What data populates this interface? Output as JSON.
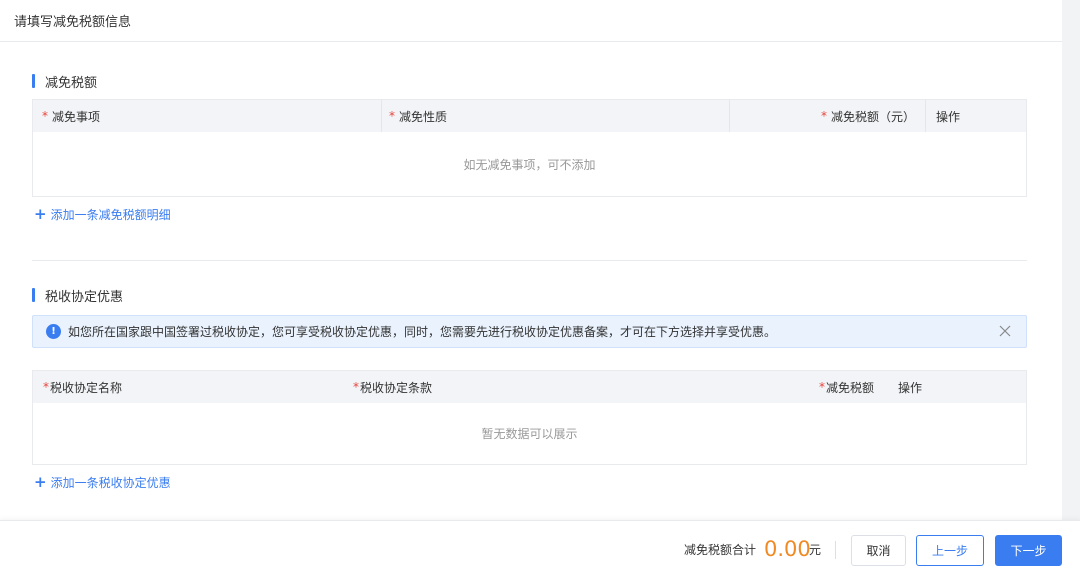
{
  "page": {
    "title": "请填写减免税额信息"
  },
  "section_relief": {
    "title": "减免税额",
    "columns": [
      {
        "label": "减免事项",
        "required": "*"
      },
      {
        "label": "减免性质",
        "required": "*"
      },
      {
        "label": "减免税额（元）",
        "required": "*"
      },
      {
        "label": "操作"
      }
    ],
    "empty_text": "如无减免事项，可不添加",
    "add_plus": "+",
    "add_label": "添加一条减免税额明细"
  },
  "section_treaty": {
    "title": "税收协定优惠",
    "notice_icon": "!",
    "notice_text": "如您所在国家跟中国签署过税收协定，您可享受税收协定优惠，同时，您需要先进行税收协定优惠备案，才可在下方选择并享受优惠。",
    "columns": [
      {
        "label": "税收协定名称",
        "required": "*"
      },
      {
        "label": "税收协定条款",
        "required": "*"
      },
      {
        "label": "减免税额",
        "required": "*"
      },
      {
        "label": "操作"
      }
    ],
    "empty_text": "暂无数据可以展示",
    "add_plus": "+",
    "add_label": "添加一条税收协定优惠"
  },
  "footer": {
    "total_label": "减免税额合计",
    "total_value": "0.00",
    "total_unit": "元",
    "cancel_label": "取消",
    "prev_label": "上一步",
    "next_label": "下一步"
  },
  "colors": {
    "accent": "#3a7df0",
    "required": "#e8453c",
    "total": "#f08a24",
    "notice_bg": "#e9f2fd"
  },
  "icons": [
    "info-icon",
    "close-icon",
    "plus-icon"
  ]
}
